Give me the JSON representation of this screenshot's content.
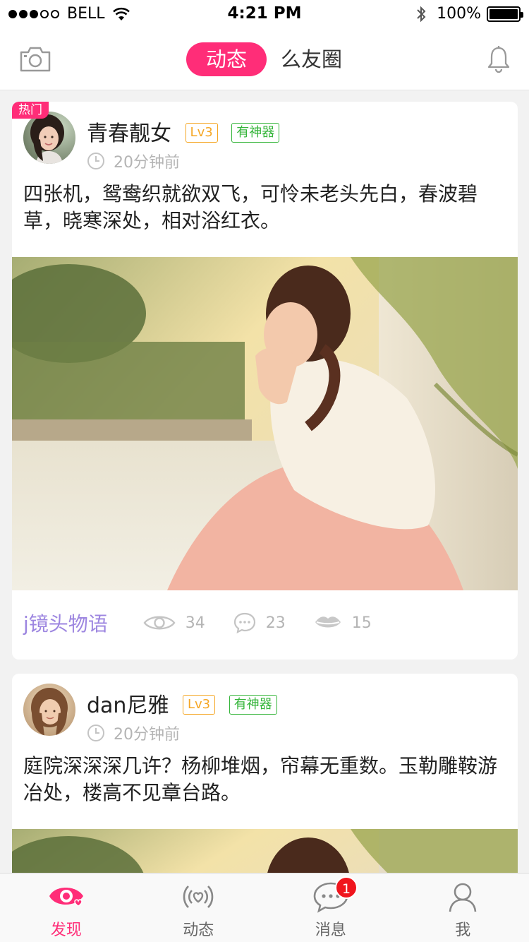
{
  "status_bar": {
    "carrier": "BELL",
    "time": "4:21 PM",
    "battery": "100%"
  },
  "nav": {
    "tab_active": "动态",
    "tab_inactive": "么友圈",
    "camera_icon": "camera-icon",
    "bell_icon": "bell-icon"
  },
  "posts": [
    {
      "hot_tag": "热门",
      "username": "青春靓女",
      "level": "Lv3",
      "badge": "有神器",
      "time": "20分钟前",
      "content": "四张机，鸳鸯织就欲双飞，可怜未老头先白，春波碧草，晓寒深处，相对浴红衣。",
      "channel": "j镜头物语",
      "views": "34",
      "comments": "23",
      "likes": "15"
    },
    {
      "username": "dan尼雅",
      "level": "Lv3",
      "badge": "有神器",
      "time": "20分钟前",
      "content": "庭院深深深几许？杨柳堆烟，帘幕无重数。玉勒雕鞍游冶处，楼高不见章台路。"
    }
  ],
  "tabbar": {
    "items": [
      {
        "label": "发现",
        "icon": "discover-eye-icon"
      },
      {
        "label": "动态",
        "icon": "activity-icon"
      },
      {
        "label": "消息",
        "icon": "message-icon",
        "badge": "1"
      },
      {
        "label": "我",
        "icon": "profile-icon"
      }
    ]
  },
  "colors": {
    "accent": "#ff2d78",
    "level_badge": "#f5a623",
    "god_badge": "#36b53b",
    "channel": "#9d86e0"
  }
}
